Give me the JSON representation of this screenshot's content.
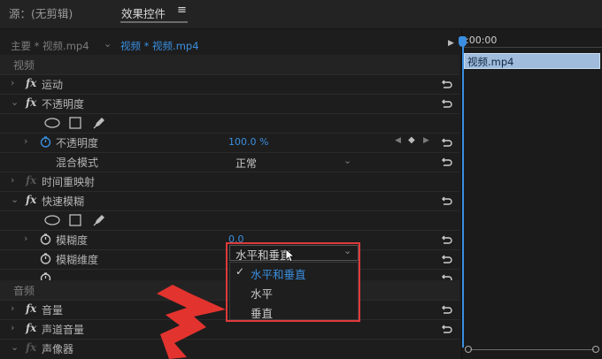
{
  "tabs": [
    {
      "label": "源：(无剪辑)"
    },
    {
      "label": "效果控件",
      "menu_icon": "≡"
    }
  ],
  "header": {
    "master_clip": "主要 * 视频.mp4",
    "active_clip": "视频 * 视频.mp4"
  },
  "timeline": {
    "timecode": ":00:00",
    "clip_label": "视频.mp4"
  },
  "sections": {
    "video": "视频",
    "audio": "音频"
  },
  "effects": {
    "motion": "运动",
    "opacity": {
      "name": "不透明度",
      "param_label": "不透明度",
      "param_value": "100.0 %",
      "blend_label": "混合模式",
      "blend_value": "正常"
    },
    "time_remap": "时间重映射",
    "fast_blur": {
      "name": "快速模糊",
      "blurriness_label": "模糊度",
      "blurriness_value": "0.0",
      "dimension_label": "模糊维度",
      "dimension_value": "水平和垂直"
    },
    "volume": "音量",
    "channel_volume": "声道音量",
    "panner": "声像器"
  },
  "dropdown_options": [
    {
      "label": "水平和垂直",
      "selected": true
    },
    {
      "label": "水平",
      "selected": false
    },
    {
      "label": "垂直",
      "selected": false
    }
  ],
  "colors": {
    "accent_blue": "#3a8fe0",
    "highlight_frame": "#e03a3a",
    "arrow_red": "#e3332f"
  }
}
